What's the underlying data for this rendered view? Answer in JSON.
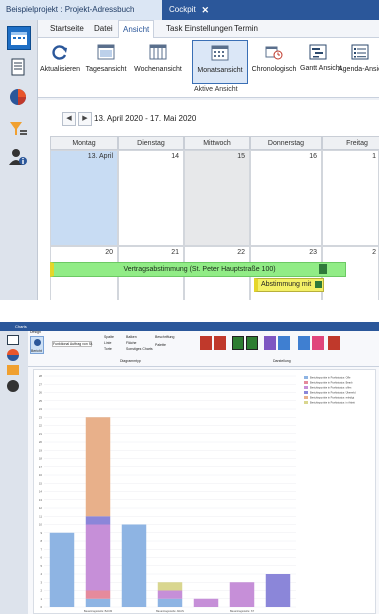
{
  "screen1": {
    "window_tabs": [
      {
        "label": "Beispielprojekt : Projekt-Adressbuch"
      },
      {
        "label": "Cockpit",
        "close": "✕"
      }
    ],
    "ribbon_tabs": [
      "Startseite",
      "Datei",
      "Ansicht",
      "Task Einstellungen",
      "Termin"
    ],
    "active_ribbon_tab": "Ansicht",
    "ribbon_buttons": [
      {
        "label": "Aktualisieren",
        "icon": "refresh-icon"
      },
      {
        "label": "Tagesansicht",
        "icon": "day-view-icon"
      },
      {
        "label": "Wochenansicht",
        "icon": "week-view-icon"
      },
      {
        "label": "Monatsansicht",
        "icon": "month-view-icon",
        "selected": true
      },
      {
        "label": "Chronologisch",
        "icon": "timeline-icon"
      },
      {
        "label": "Gantt Ansicht",
        "icon": "gantt-icon"
      },
      {
        "label": "Agenda-Ansicht",
        "icon": "agenda-icon"
      }
    ],
    "ribbon_group_label": "Aktive Ansicht",
    "calendar": {
      "prev": "◀",
      "next": "▶",
      "date_range": "13. April 2020 - 17. Mai 2020",
      "day_headers": [
        "Montag",
        "Dienstag",
        "Mittwoch",
        "Donnerstag",
        "Freitag"
      ],
      "week1": [
        "13. April",
        "14",
        "15",
        "16",
        "1"
      ],
      "week2": [
        "20",
        "21",
        "22",
        "23",
        "2"
      ],
      "event_main": "Vertragsabstimmung (St. Peter Hauptstraße 100)",
      "event_second": "Abstimmung mit"
    },
    "colors": {
      "accent": "#2b579a",
      "event_green": "#91ec86",
      "event_yellow": "#f4f066",
      "today": "#c8dcf3"
    }
  },
  "screen2": {
    "title": "Charts",
    "ribbon_tab": "Design",
    "ribbon_button": "Bericht",
    "dropdown_value": "Funktional Auftrag von St.",
    "group_labels": [
      "Diagrammtyp",
      "Darstellung"
    ],
    "option_labels": [
      "Spalte",
      "Linie",
      "Torte",
      "Balken",
      "Fläche",
      "Sonstiges Charts",
      "Beschriftung",
      "Palette"
    ],
    "chart_data": {
      "type": "bar",
      "stacked": true,
      "title": "",
      "ylim": [
        0,
        28
      ],
      "y_ticks": [
        0,
        1,
        2,
        3,
        4,
        5,
        6,
        7,
        8,
        9,
        10,
        11,
        12,
        13,
        14,
        15,
        16,
        17,
        18,
        19,
        20,
        21,
        22,
        23,
        24,
        25,
        26,
        27,
        28
      ],
      "categories": [
        "",
        "Bauantragsstelle: BAUM",
        "",
        "Bauantragsstelle: ANAN",
        "",
        "Bauantragsstelle: ST",
        ""
      ],
      "series": [
        {
          "name": "Berichtspunkte in Punktstatus: Offe",
          "color": "#8eb4e3",
          "values": [
            9,
            1,
            10,
            1,
            0,
            0,
            0
          ]
        },
        {
          "name": "Berichtspunkte in Punktstatus: Bearb",
          "color": "#e58a9c",
          "values": [
            0,
            1,
            0,
            0,
            0,
            0,
            0
          ]
        },
        {
          "name": "Berichtspunkte in Punktstatus: offen",
          "color": "#c68fd8",
          "values": [
            0,
            8,
            0,
            1,
            1,
            3,
            0
          ]
        },
        {
          "name": "Berichtspunkte in Punktstatus: Übererld",
          "color": "#8b86d9",
          "values": [
            0,
            1,
            0,
            0,
            0,
            0,
            4
          ]
        },
        {
          "name": "Berichtspunkte in Punktstatus: erledigt",
          "color": "#e8b08a",
          "values": [
            0,
            12,
            0,
            0,
            0,
            0,
            0
          ]
        },
        {
          "name": "Berichtspunkte in Punktstatus: in Arbeit",
          "color": "#d9d68f",
          "values": [
            0,
            0,
            0,
            1,
            0,
            0,
            0
          ]
        }
      ],
      "legend": "top-right"
    }
  }
}
